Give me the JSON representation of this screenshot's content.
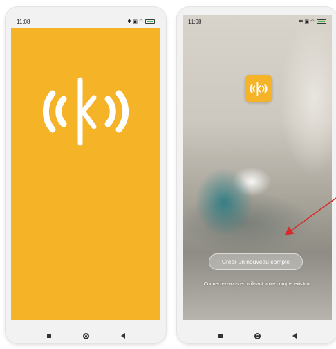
{
  "left_phone": {
    "status_time": "11:08",
    "status_icons": "✱ ▣ ◠",
    "splash_color": "#f5b328"
  },
  "right_phone": {
    "status_time": "11:08",
    "status_icons": "✱ ▣ ◠",
    "create_account_label": "Créer un nouveau compte",
    "login_prompt": "Connectez-vous en utilisant votre compte existant"
  },
  "navigation": {
    "icons": [
      "recent-apps-icon",
      "home-icon",
      "back-icon"
    ]
  },
  "colors": {
    "brand": "#f5b328",
    "annotation_arrow": "#d62b2b"
  }
}
